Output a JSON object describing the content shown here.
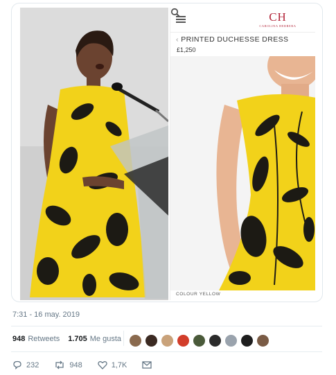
{
  "product": {
    "brand": "CH",
    "brand_sub": "CAROLINA HERRERA",
    "title": "PRINTED DUCHESSE DRESS",
    "price": "£1,250",
    "colour": "COLOUR YELLOW"
  },
  "tweet": {
    "timestamp": "7:31 - 16 may. 2019",
    "retweets_count": "948",
    "retweets_label": "Retweets",
    "likes_count": "1.705",
    "likes_label": "Me gusta",
    "reply_count": "232",
    "retweet_count": "948",
    "like_count": "1,7K"
  },
  "colors": {
    "dress_yellow": "#f2d21a",
    "brand_red": "#b3263a",
    "muted": "#657786"
  },
  "avatars": [
    "#8a6a4e",
    "#3b2a22",
    "#c9a27a",
    "#d23d2a",
    "#4a5a3a",
    "#2b2b2b",
    "#9aa3ad",
    "#1e1e1e",
    "#7a5b45"
  ]
}
